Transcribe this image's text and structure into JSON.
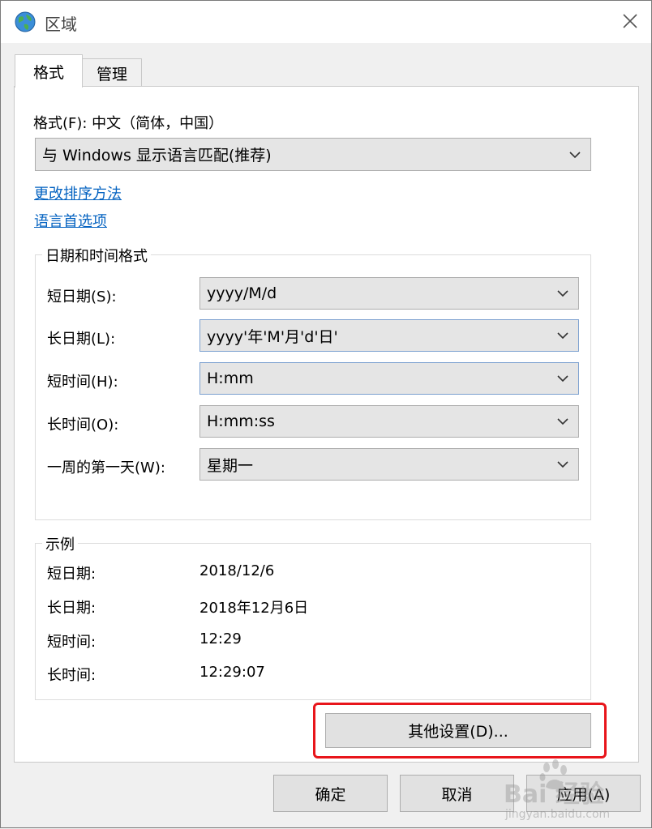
{
  "window": {
    "title": "区域",
    "icon": "globe-icon",
    "close_icon": "close-icon"
  },
  "tabs": [
    {
      "label": "格式",
      "active": true
    },
    {
      "label": "管理",
      "active": false
    }
  ],
  "format_section": {
    "format_label": "格式(F): 中文（简体，中国）",
    "format_select_value": "与 Windows 显示语言匹配(推荐)",
    "link_sort": "更改排序方法",
    "link_language": "语言首选项"
  },
  "datetime_group": {
    "title": "日期和时间格式",
    "rows": [
      {
        "label": "短日期(S):",
        "value": "yyyy/M/d"
      },
      {
        "label": "长日期(L):",
        "value": "yyyy'年'M'月'd'日'"
      },
      {
        "label": "短时间(H):",
        "value": "H:mm"
      },
      {
        "label": "长时间(O):",
        "value": "H:mm:ss"
      },
      {
        "label": "一周的第一天(W):",
        "value": "星期一"
      }
    ]
  },
  "example_group": {
    "title": "示例",
    "rows": [
      {
        "label": "短日期:",
        "value": "2018/12/6"
      },
      {
        "label": "长日期:",
        "value": "2018年12月6日"
      },
      {
        "label": "短时间:",
        "value": "12:29"
      },
      {
        "label": "长时间:",
        "value": "12:29:07"
      }
    ]
  },
  "buttons": {
    "additional_settings": "其他设置(D)...",
    "ok": "确定",
    "cancel": "取消",
    "apply": "应用(A)"
  },
  "colors": {
    "link": "#0563c1",
    "highlight": "#e8151b",
    "combo_bg": "#e5e5e5"
  },
  "watermark": {
    "brand": "Bai 经验",
    "url": "jingyan.baidu.com"
  }
}
